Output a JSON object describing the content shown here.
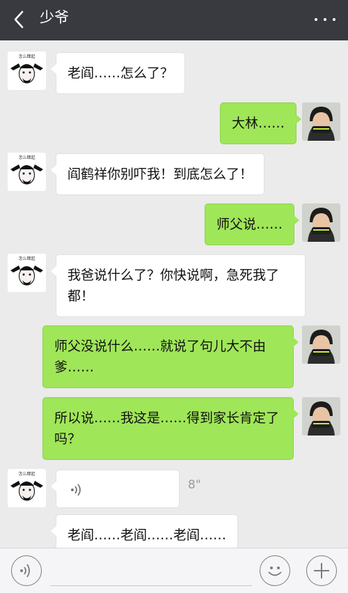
{
  "header": {
    "title": "少爷",
    "back_icon": "chevron-left-icon",
    "more_icon": "more-dots-icon",
    "background": "#393a3f"
  },
  "messages": [
    {
      "side": "in",
      "text": "老阎……怎么了？"
    },
    {
      "side": "out",
      "text": "大林……"
    },
    {
      "side": "in",
      "text": "阎鹤祥你别吓我！到底怎么了！"
    },
    {
      "side": "out",
      "text": "师父说……"
    },
    {
      "side": "in",
      "text": "我爸说什么了？你快说啊，急死我了都！"
    },
    {
      "side": "out",
      "text": "师父没说什么……就说了句儿大不由爹……"
    },
    {
      "side": "out",
      "text": "所以说……我这是……得到家长肯定了吗？"
    },
    {
      "side": "in",
      "type": "voice",
      "duration": "8\""
    },
    {
      "side": "in",
      "text": "老阎……老阎……老阎……"
    }
  ],
  "avatars": {
    "left_caption": "怎么肆起"
  },
  "bottom_bar": {
    "voice_icon": "voice-icon",
    "emoji_icon": "emoji-icon",
    "add_icon": "plus-icon",
    "input_value": ""
  },
  "colors": {
    "chat_background": "#ebebeb",
    "outgoing_bubble": "#9fe658",
    "incoming_bubble": "#ffffff"
  }
}
